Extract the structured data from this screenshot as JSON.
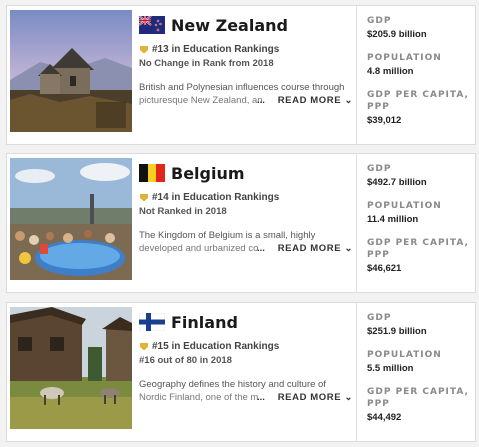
{
  "labels": {
    "gdp": "GDP",
    "population": "POPULATION",
    "gdp_per_capita": "GDP PER CAPITA, PPP",
    "read_more": "READ MORE",
    "ellipsis": "..."
  },
  "countries": [
    {
      "name": "New Zealand",
      "flag_icon": "new-zealand-flag-icon",
      "photo": "stone-church-landscape",
      "rank_number": "#13",
      "rank_text": "in Education Rankings",
      "rank_sub": "No Change in Rank from 2018",
      "desc_line1": "British and Polynesian influences course through",
      "desc_line2": "picturesque New Zealand, an",
      "gdp": "$205.9 billion",
      "population": "4.8 million",
      "gdp_per_capita": "$39,012"
    },
    {
      "name": "Belgium",
      "flag_icon": "belgium-flag-icon",
      "photo": "crowd-at-pool",
      "rank_number": "#14",
      "rank_text": "in Education Rankings",
      "rank_sub": "Not Ranked in 2018",
      "desc_line1": "The Kingdom of Belgium is a small, highly",
      "desc_line2": "developed and urbanized co",
      "gdp": "$492.7 billion",
      "population": "11.4 million",
      "gdp_per_capita": "$46,621"
    },
    {
      "name": "Finland",
      "flag_icon": "finland-flag-icon",
      "photo": "reindeer-by-cabin",
      "rank_number": "#15",
      "rank_text": "in Education Rankings",
      "rank_sub": "#16 out of 80 in 2018",
      "desc_line1": "Geography defines the history and culture of",
      "desc_line2": "Nordic Finland, one of the m",
      "gdp": "$251.9 billion",
      "population": "5.5 million",
      "gdp_per_capita": "$44,492"
    }
  ],
  "colors": {
    "medal": "#e0b23a",
    "label": "#8a8a8a",
    "text": "#1a1a1a"
  }
}
